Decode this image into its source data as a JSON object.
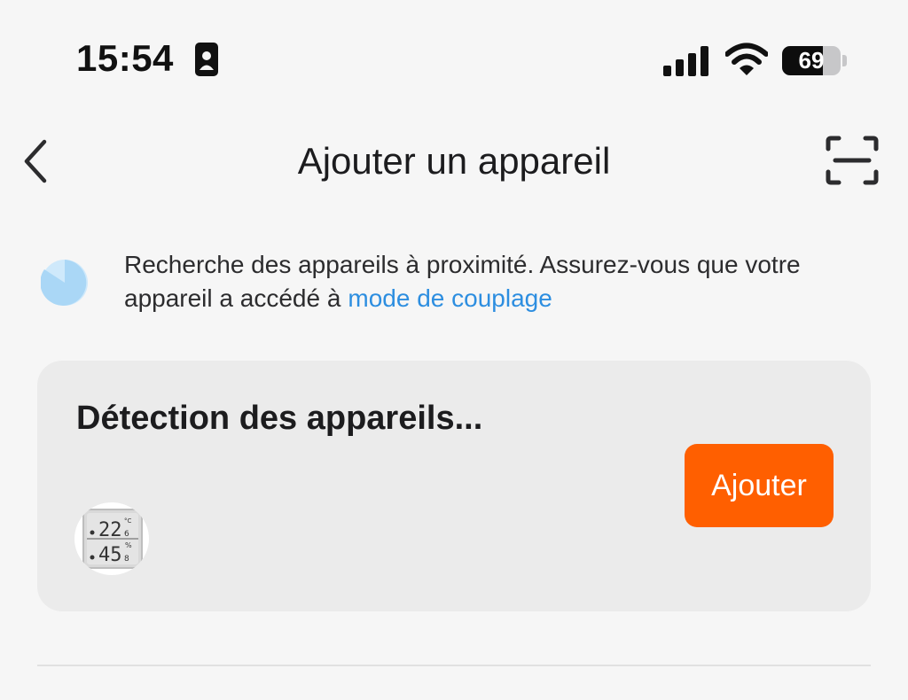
{
  "status_bar": {
    "time": "15:54",
    "battery_level": "69",
    "battery_fraction": 0.69,
    "icons": [
      "id-card-icon",
      "cellular-signal-icon",
      "wifi-icon",
      "battery-icon"
    ]
  },
  "nav": {
    "title": "Ajouter un appareil",
    "back_icon": "chevron-left-icon",
    "scan_icon": "scan-icon"
  },
  "search_hint": {
    "text": "Recherche des appareils à proximité. Assurez-vous que votre appareil a accédé à",
    "link_text": "mode de couplage",
    "link_color": "#2d8ee0"
  },
  "detection_card": {
    "title": "Détection des appareils...",
    "add_button_label": "Ajouter",
    "add_button_color": "#ff5f00",
    "device": {
      "icon": "thermometer-hygrometer-icon",
      "display_temp": "22",
      "display_temp_decimal": "6",
      "display_temp_unit": "°C",
      "display_humidity": "45",
      "display_humidity_decimal": "8",
      "display_humidity_unit": "%"
    }
  }
}
